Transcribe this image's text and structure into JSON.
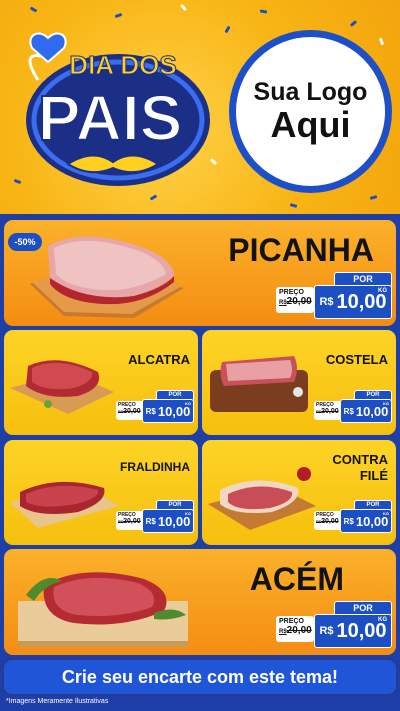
{
  "header": {
    "campaign_title_line1": "DIA DOS",
    "campaign_title_line2": "PAIS",
    "logo_line1": "Sua Logo",
    "logo_line2": "Aqui"
  },
  "discount_badge": "-50%",
  "price_labels": {
    "por": "POR",
    "preco": "PREÇO",
    "currency": "R$",
    "unit": "KG"
  },
  "products": [
    {
      "name": "PICANHA",
      "old_prefix": "R$",
      "old_price": "20,00",
      "price": "10,00"
    },
    {
      "name": "ALCATRA",
      "old_prefix": "R$",
      "old_price": "20,00",
      "price": "10,00"
    },
    {
      "name": "COSTELA",
      "old_prefix": "R$",
      "old_price": "20,00",
      "price": "10,00"
    },
    {
      "name": "FRALDINHA",
      "old_prefix": "R$",
      "old_price": "20,00",
      "price": "10,00"
    },
    {
      "name_line1": "CONTRA",
      "name_line2": "FILÉ",
      "old_prefix": "R$",
      "old_price": "20,00",
      "price": "10,00"
    },
    {
      "name": "ACÉM",
      "old_prefix": "R$",
      "old_price": "20,00",
      "price": "10,00"
    }
  ],
  "cta": "Crie seu encarte com este tema!",
  "disclaimer": "*Imagens Meramente Ilustrativas",
  "colors": {
    "brand_blue": "#1d4fc4",
    "orange": "#f48d12",
    "yellow": "#fdd427"
  }
}
